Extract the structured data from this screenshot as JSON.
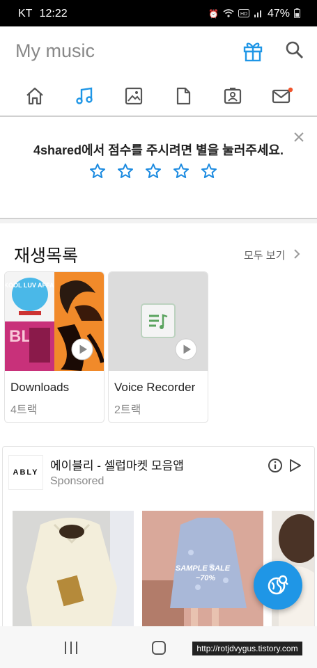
{
  "status": {
    "carrier": "KT",
    "time": "12:22",
    "battery": "47%"
  },
  "header": {
    "title": "My music"
  },
  "tabs": [
    "home",
    "music",
    "photos",
    "documents",
    "contacts",
    "messages"
  ],
  "rating": {
    "message": "4shared에서 점수를 주시려면 별을 눌러주세요.",
    "stars": 5
  },
  "playlists": {
    "heading": "재생목록",
    "see_all": "모두 보기",
    "items": [
      {
        "name": "Downloads",
        "count": "4트랙"
      },
      {
        "name": "Voice Recorder",
        "count": "2트랙"
      }
    ]
  },
  "ad": {
    "logo": "ABLY",
    "title": "에이블리 - 셀럽마켓 모음앱",
    "sponsored": "Sponsored",
    "sale_text": "SAMPLE SALE",
    "sale_pct": "~70%"
  },
  "art": {
    "album_tag": "SKOOL LUV AFFAIR"
  },
  "watermark": "http://rotjdvygus.tistory.com",
  "colors": {
    "accent": "#1f96e6",
    "star": "#1a8ae0",
    "notify": "#f0542c"
  }
}
